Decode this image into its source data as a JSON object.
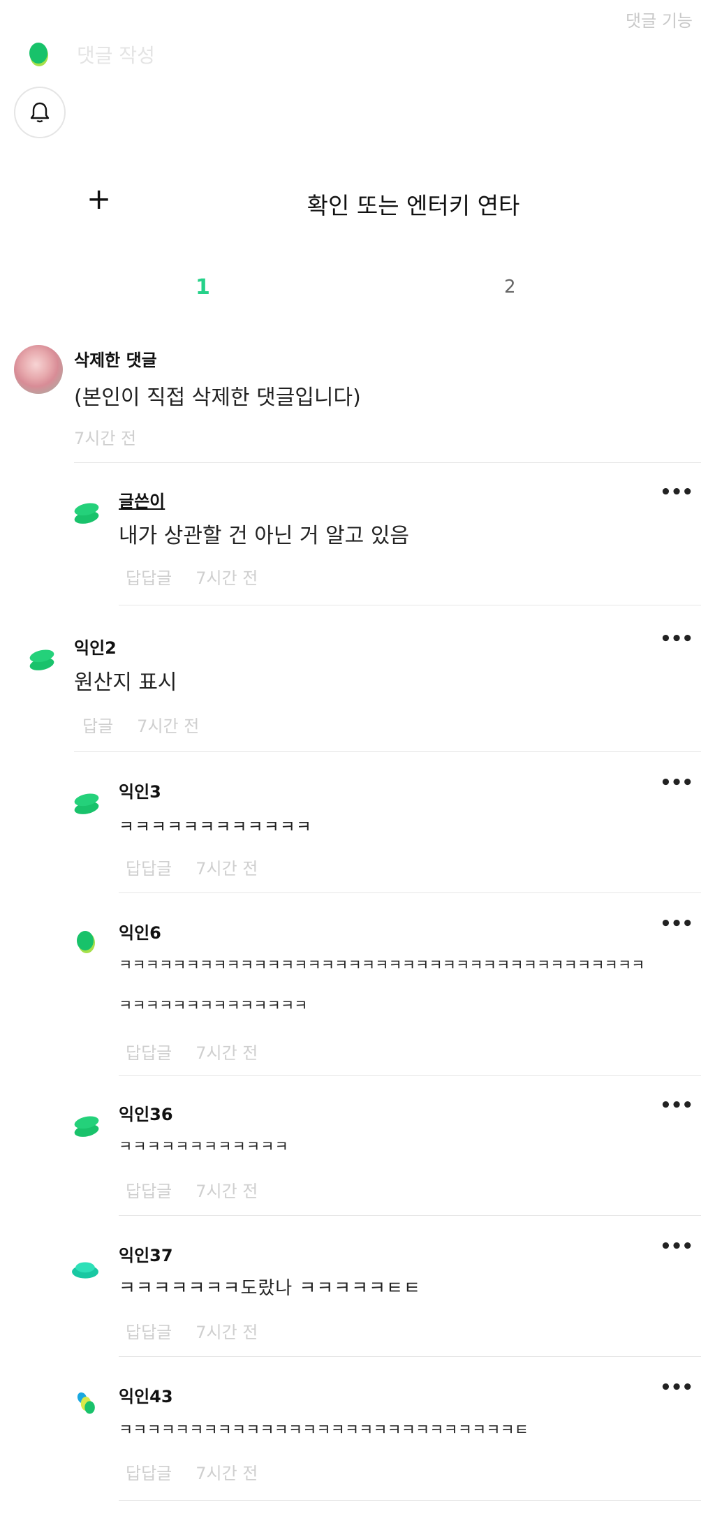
{
  "header": {
    "comment_feature_link": "댓글 기능",
    "input_placeholder": "댓글 작성"
  },
  "composer": {
    "add_label": "+",
    "hint": "확인 또는 엔터키 연타"
  },
  "pagination": {
    "pages": [
      "1",
      "2"
    ],
    "current": "1"
  },
  "comments": [
    {
      "author": "삭제한 댓글",
      "text": "(본인이 직접 삭제한 댓글입니다)",
      "time": "7시간 전",
      "reply_label": "",
      "avatar": "photo"
    },
    {
      "author": "글쓴이",
      "text": "내가 상관할 건 아닌 거 알고 있음",
      "time": "7시간 전",
      "reply_label": "답답글",
      "avatar": "stack-green"
    },
    {
      "author": "익인2",
      "text": "원산지 표시",
      "time": "7시간 전",
      "reply_label": "답글",
      "avatar": "stack-green"
    },
    {
      "author": "익인3",
      "text": "ㅋㅋㅋㅋㅋㅋㅋㅋㅋㅋㅋㅋ",
      "time": "7시간 전",
      "reply_label": "답답글",
      "avatar": "stack-green"
    },
    {
      "author": "익인6",
      "text_line1": "ㅋㅋㅋㅋㅋㅋㅋㅋㅋㅋㅋㅋㅋㅋㅋㅋㅋㅋㅋㅋㅋㅋㅋㅋㅋㅋㅋㅋㅋㅋㅋㅋㅋㅋㅋㅋㅋㅋㅋ",
      "text_line2": "ㅋㅋㅋㅋㅋㅋㅋㅋㅋㅋㅋㅋㅋㅋ",
      "time": "7시간 전",
      "reply_label": "답답글",
      "avatar": "blob-green"
    },
    {
      "author": "익인36",
      "text": "ㅋㅋㅋㅋㅋㅋㅋㅋㅋㅋㅋㅋ",
      "time": "7시간 전",
      "reply_label": "답답글",
      "avatar": "stack-green"
    },
    {
      "author": "익인37",
      "text": "ㅋㅋㅋㅋㅋㅋㅋ도랐나 ㅋㅋㅋㅋㅋㅌㅌ",
      "time": "7시간 전",
      "reply_label": "답답글",
      "avatar": "disc-teal"
    },
    {
      "author": "익인43",
      "text": "ㅋㅋㅋㅋㅋㅋㅋㅋㅋㅋㅋㅋㅋㅋㅋㅋㅋㅋㅋㅋㅋㅋㅋㅋㅋㅋㅋㅋㅌ",
      "time": "7시간 전",
      "reply_label": "답답글",
      "avatar": "multi"
    }
  ],
  "more_label": "•••",
  "colors": {
    "accent": "#25d189",
    "muted": "#cfcfcf",
    "divider": "#e6e6e6"
  }
}
